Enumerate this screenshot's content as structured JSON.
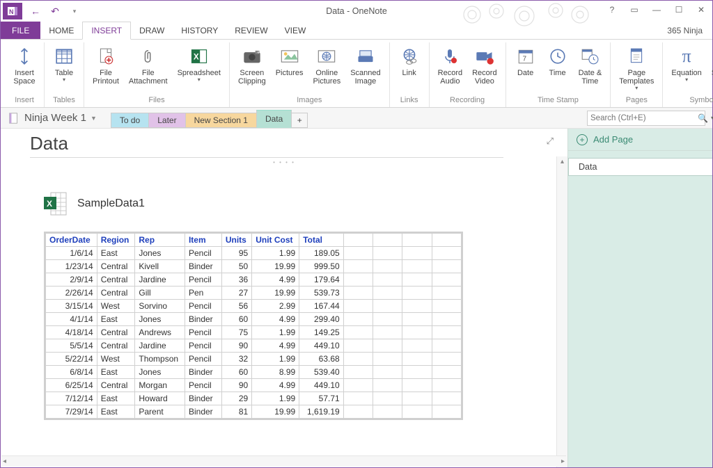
{
  "window": {
    "title": "Data - OneNote",
    "account": "365 Ninja"
  },
  "ribbonTabs": {
    "file": "FILE",
    "home": "HOME",
    "insert": "INSERT",
    "draw": "DRAW",
    "history": "HISTORY",
    "review": "REVIEW",
    "view": "VIEW"
  },
  "ribbon": {
    "insert": {
      "insertSpace": "Insert\nSpace",
      "group": "Insert"
    },
    "tables": {
      "table": "Table",
      "group": "Tables"
    },
    "files": {
      "printout": "File\nPrintout",
      "attach": "File\nAttachment",
      "spreadsheet": "Spreadsheet",
      "group": "Files"
    },
    "images": {
      "clipping": "Screen\nClipping",
      "pictures": "Pictures",
      "online": "Online\nPictures",
      "scanned": "Scanned\nImage",
      "group": "Images"
    },
    "links": {
      "link": "Link",
      "group": "Links"
    },
    "recording": {
      "audio": "Record\nAudio",
      "video": "Record\nVideo",
      "group": "Recording"
    },
    "timestamp": {
      "date": "Date",
      "time": "Time",
      "datetime": "Date &\nTime",
      "group": "Time Stamp"
    },
    "pages": {
      "templates": "Page\nTemplates",
      "group": "Pages"
    },
    "symbols": {
      "equation": "Equation",
      "symbol": "Symbol",
      "group": "Symbols"
    }
  },
  "notebook": {
    "name": "Ninja Week 1"
  },
  "sections": {
    "todo": "To do",
    "later": "Later",
    "new": "New Section 1",
    "data": "Data",
    "addGlyph": "+"
  },
  "search": {
    "placeholder": "Search (Ctrl+E)"
  },
  "page": {
    "title": "Data",
    "attachment": "SampleData1"
  },
  "pageList": {
    "add": "Add Page",
    "item0": "Data"
  },
  "table": {
    "headers": [
      "OrderDate",
      "Region",
      "Rep",
      "Item",
      "Units",
      "Unit Cost",
      "Total"
    ],
    "rows": [
      [
        "1/6/14",
        "East",
        "Jones",
        "Pencil",
        "95",
        "1.99",
        "189.05"
      ],
      [
        "1/23/14",
        "Central",
        "Kivell",
        "Binder",
        "50",
        "19.99",
        "999.50"
      ],
      [
        "2/9/14",
        "Central",
        "Jardine",
        "Pencil",
        "36",
        "4.99",
        "179.64"
      ],
      [
        "2/26/14",
        "Central",
        "Gill",
        "Pen",
        "27",
        "19.99",
        "539.73"
      ],
      [
        "3/15/14",
        "West",
        "Sorvino",
        "Pencil",
        "56",
        "2.99",
        "167.44"
      ],
      [
        "4/1/14",
        "East",
        "Jones",
        "Binder",
        "60",
        "4.99",
        "299.40"
      ],
      [
        "4/18/14",
        "Central",
        "Andrews",
        "Pencil",
        "75",
        "1.99",
        "149.25"
      ],
      [
        "5/5/14",
        "Central",
        "Jardine",
        "Pencil",
        "90",
        "4.99",
        "449.10"
      ],
      [
        "5/22/14",
        "West",
        "Thompson",
        "Pencil",
        "32",
        "1.99",
        "63.68"
      ],
      [
        "6/8/14",
        "East",
        "Jones",
        "Binder",
        "60",
        "8.99",
        "539.40"
      ],
      [
        "6/25/14",
        "Central",
        "Morgan",
        "Pencil",
        "90",
        "4.99",
        "449.10"
      ],
      [
        "7/12/14",
        "East",
        "Howard",
        "Binder",
        "29",
        "1.99",
        "57.71"
      ],
      [
        "7/29/14",
        "East",
        "Parent",
        "Binder",
        "81",
        "19.99",
        "1,619.19"
      ]
    ]
  }
}
